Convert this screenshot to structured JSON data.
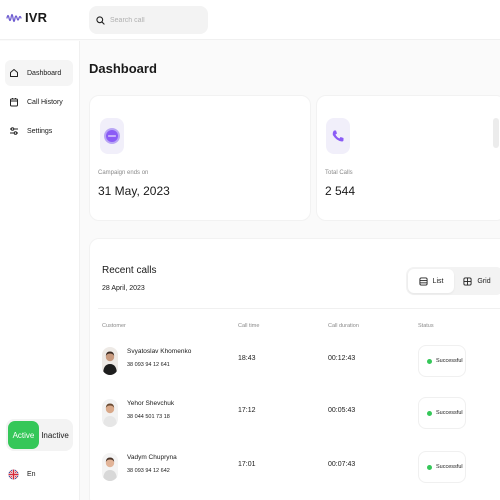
{
  "app": {
    "logo_text": "IVR"
  },
  "search": {
    "placeholder": "Search call",
    "value": ""
  },
  "sidebar": {
    "items": [
      {
        "label": "Dashboard",
        "icon": "home-icon",
        "active": true
      },
      {
        "label": "Call History",
        "icon": "calendar-icon",
        "active": false
      },
      {
        "label": "Settings",
        "icon": "sliders-icon",
        "active": false
      }
    ],
    "toggle": {
      "active_label": "Active",
      "inactive_label": "Inactive",
      "selected": "Active"
    },
    "language": {
      "label": "En",
      "icon": "uk-flag-icon"
    }
  },
  "page": {
    "title": "Dashboard"
  },
  "stats": [
    {
      "label": "Campaign ends on",
      "value": "31 May, 2023",
      "icon": "campaign-icon",
      "accent": "#8b5cf6"
    },
    {
      "label": "Total Calls",
      "value": "2 544",
      "icon": "phone-icon",
      "accent": "#8b5cf6"
    }
  ],
  "recent_calls": {
    "title": "Recent calls",
    "date": "28 April, 2023",
    "view": {
      "list_label": "List",
      "grid_label": "Grid",
      "selected": "List"
    },
    "columns": [
      "Customer",
      "Call time",
      "Call duration",
      "Status"
    ],
    "rows": [
      {
        "name": "Svyatoslav Khomenko",
        "phone": "38 093 94 12 641",
        "time": "18:43",
        "duration": "00:12:43",
        "status": "Successful"
      },
      {
        "name": "Yehor Shevchuk",
        "phone": "38 044 501 73 18",
        "time": "17:12",
        "duration": "00:05:43",
        "status": "Successful"
      },
      {
        "name": "Vadym Chupryna",
        "phone": "38 093 94 12 642",
        "time": "17:01",
        "duration": "00:07:43",
        "status": "Successful"
      }
    ]
  },
  "colors": {
    "success": "#35c759",
    "accent": "#8b5cf6"
  }
}
